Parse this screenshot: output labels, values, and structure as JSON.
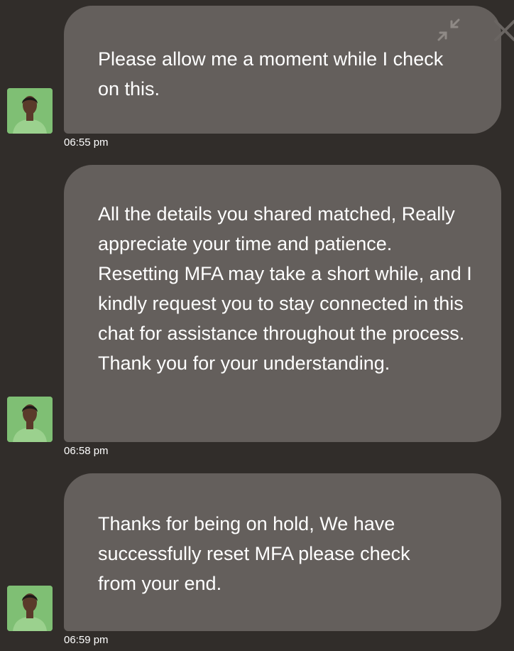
{
  "chat": {
    "messages": [
      {
        "text": "Please allow me a moment while I check on this.",
        "time": "06:55 pm"
      },
      {
        "text": "All the details you shared matched, Really appreciate your time and patience. Resetting MFA may take a short while, and I kindly request you to stay connected in this chat for assistance throughout the process. Thank you for your understanding.",
        "time": "06:58 pm"
      },
      {
        "text": "Thanks for being on hold, We have successfully reset MFA please check from your end.",
        "time": "06:59 pm"
      }
    ]
  },
  "controls": {
    "minimize_icon": "collapse-arrows-icon",
    "close_icon": "close-icon"
  },
  "colors": {
    "background": "#312d2a",
    "bubble": "#645f5c",
    "text": "#ffffff",
    "avatar_bg": "#7fbf74"
  }
}
